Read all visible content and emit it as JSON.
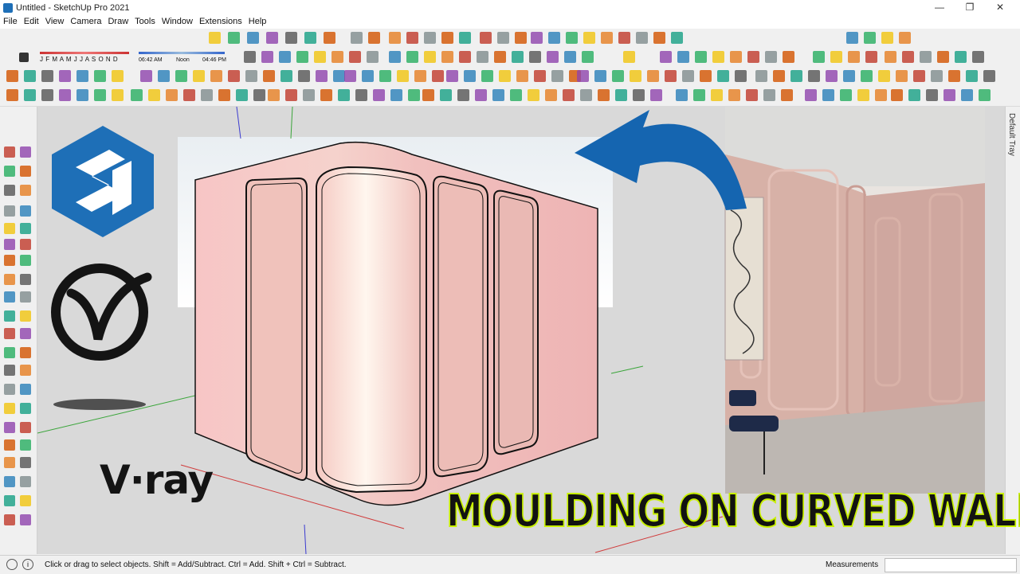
{
  "window": {
    "title": "Untitled - SketchUp Pro 2021",
    "controls": [
      "—",
      "❐",
      "✕"
    ]
  },
  "menu": [
    "File",
    "Edit",
    "View",
    "Camera",
    "Draw",
    "Tools",
    "Window",
    "Extensions",
    "Help"
  ],
  "shadow_bar": {
    "months": "J F M A M J J A S O N D",
    "time_start": "06:42 AM",
    "time_noon": "Noon",
    "time_end": "04:46 PM"
  },
  "tray": {
    "label": "Default Tray"
  },
  "overlay": {
    "headline": "MOULDING ON CURVED WALL",
    "logo_text": "V·ray"
  },
  "status": {
    "hint": "Click or drag to select objects. Shift = Add/Subtract. Ctrl = Add. Shift + Ctrl = Subtract.",
    "measurements_label": "Measurements",
    "measurements_value": ""
  },
  "colors": {
    "sketchup_blue": "#1e6fb7",
    "wall_pink": "#f2b8b8",
    "headline_stroke": "#c8f000",
    "arrow_blue": "#1565b0"
  }
}
